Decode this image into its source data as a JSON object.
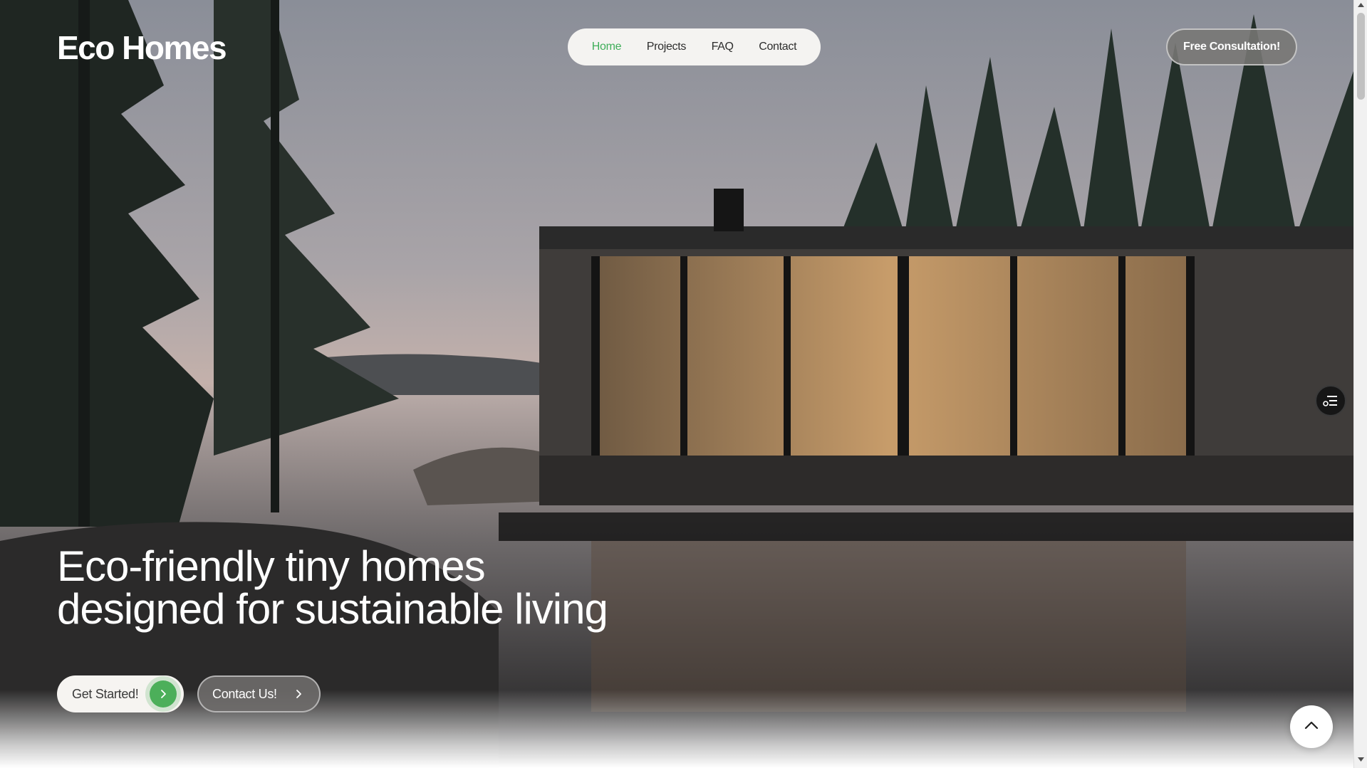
{
  "brand": {
    "name": "Eco Homes"
  },
  "nav": {
    "items": [
      {
        "label": "Home",
        "active": true
      },
      {
        "label": "Projects",
        "active": false
      },
      {
        "label": "FAQ",
        "active": false
      },
      {
        "label": "Contact",
        "active": false
      }
    ]
  },
  "header": {
    "cta_label": "Free Consultation!"
  },
  "hero": {
    "headline_line1": "Eco-friendly tiny homes",
    "headline_line2": "designed for sustainable living",
    "primary_cta": "Get Started!",
    "secondary_cta": "Contact Us!",
    "background_image": "modern-cabin-lake-forest"
  },
  "icons": {
    "primary_cta_icon": "chevron-right-icon",
    "secondary_cta_icon": "chevron-right-icon",
    "side_tool_icon": "settings-sliders-icon",
    "scroll_top_icon": "chevron-up-icon"
  },
  "colors": {
    "accent": "#4caf5a",
    "nav_active": "#3fae5a",
    "nav_bg": "#f4f3f1",
    "text_light": "#ffffff"
  }
}
